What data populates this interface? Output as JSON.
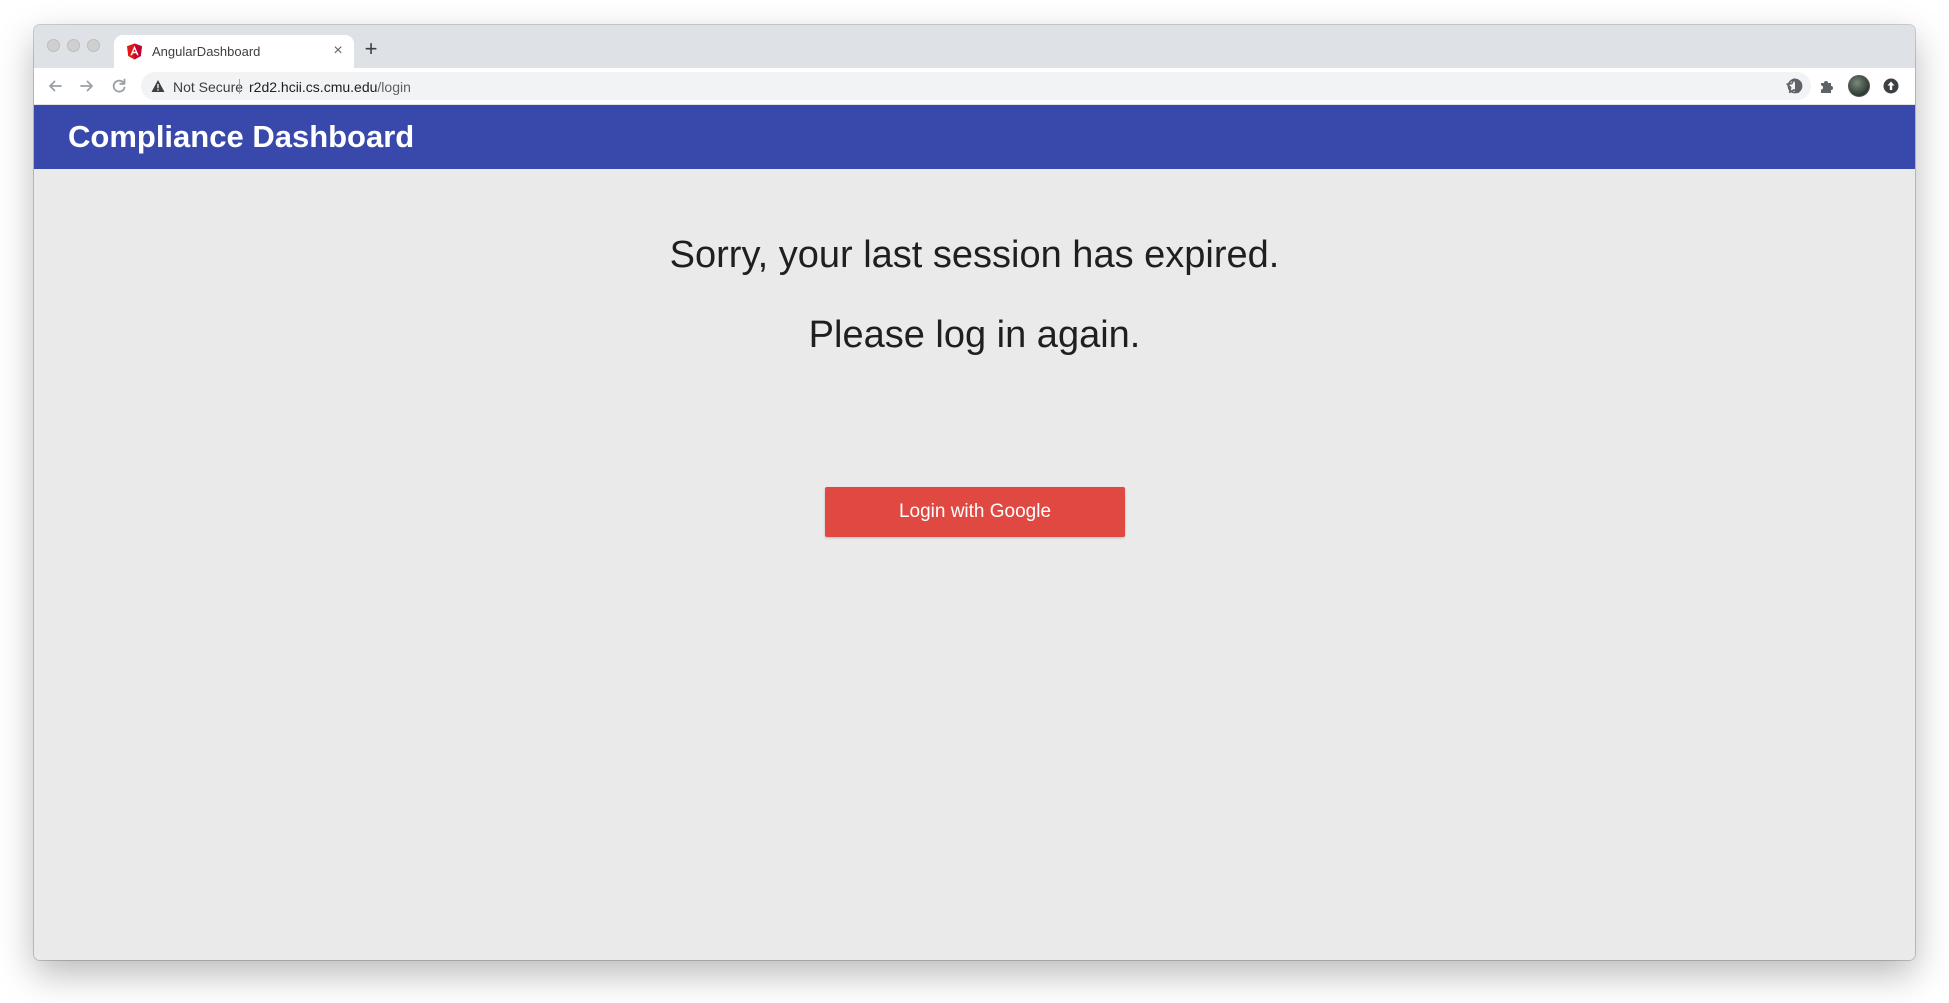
{
  "browser": {
    "tab": {
      "title": "AngularDashboard",
      "favicon": "angular-logo-icon",
      "close_glyph": "×"
    },
    "new_tab_glyph": "+",
    "omnibox": {
      "security_label": "Not Secure",
      "url_host": "r2d2.hcii.cs.cmu.edu",
      "url_path": "/login"
    },
    "icons": [
      "back-arrow-icon",
      "forward-arrow-icon",
      "reload-icon",
      "warning-icon",
      "bookmark-star-icon",
      "extension-icon",
      "puzzle-extensions-icon",
      "profile-avatar",
      "update-icon"
    ]
  },
  "app": {
    "title": "Compliance Dashboard",
    "header_color": "#3949ab"
  },
  "main": {
    "message_line1": "Sorry, your last session has expired.",
    "message_line2": "Please log in again.",
    "login_button_label": "Login with Google",
    "login_button_color": "#e04842"
  }
}
